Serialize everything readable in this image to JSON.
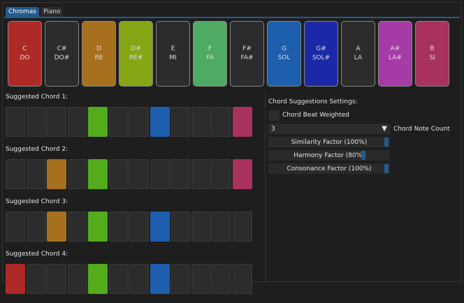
{
  "tabs": [
    {
      "label": "Chromas",
      "active": true
    },
    {
      "label": "Piano",
      "active": false
    }
  ],
  "chromas": [
    {
      "note": "C",
      "solfege": "DO",
      "color": "#ae2a26"
    },
    {
      "note": "C#",
      "solfege": "DO#",
      "color": "#2c2c2c"
    },
    {
      "note": "D",
      "solfege": "RE",
      "color": "#a6701f"
    },
    {
      "note": "D#",
      "solfege": "RE#",
      "color": "#86a616"
    },
    {
      "note": "E",
      "solfege": "MI",
      "color": "#2c2c2c"
    },
    {
      "note": "F",
      "solfege": "FA",
      "color": "#4faa63"
    },
    {
      "note": "F#",
      "solfege": "FA#",
      "color": "#2c2c2c"
    },
    {
      "note": "G",
      "solfege": "SOL",
      "color": "#1d5eae"
    },
    {
      "note": "G#",
      "solfege": "SOL#",
      "color": "#1b29a8"
    },
    {
      "note": "A",
      "solfege": "LA",
      "color": "#2c2c2c"
    },
    {
      "note": "A#",
      "solfege": "LA#",
      "color": "#a43ba6"
    },
    {
      "note": "B",
      "solfege": "SI",
      "color": "#a8315f"
    }
  ],
  "suggestions": [
    {
      "label": "Suggested Chord 1:",
      "active": {
        "4": "#52ac1c",
        "7": "#1d5eae",
        "11": "#a8315f"
      }
    },
    {
      "label": "Suggested Chord 2:",
      "active": {
        "2": "#a6701f",
        "4": "#52ac1c",
        "11": "#a8315f"
      }
    },
    {
      "label": "Suggested Chord 3:",
      "active": {
        "2": "#a6701f",
        "4": "#52ac1c",
        "7": "#1d5eae"
      }
    },
    {
      "label": "Suggested Chord 4:",
      "active": {
        "0": "#ae2a26",
        "4": "#52ac1c",
        "7": "#1d5eae"
      }
    }
  ],
  "settings": {
    "title": "Chord Suggestions Settings:",
    "beat_weighted": {
      "label": "Chord Beat Weighted",
      "checked": false
    },
    "note_count": {
      "value": "3",
      "label": "Chord Note Count"
    },
    "sliders": [
      {
        "label": "Similarity Factor (100%)",
        "value": 100
      },
      {
        "label": "Harmony Factor (80%)",
        "value": 80
      },
      {
        "label": "Consonance Factor (100%)",
        "value": 100
      }
    ]
  }
}
